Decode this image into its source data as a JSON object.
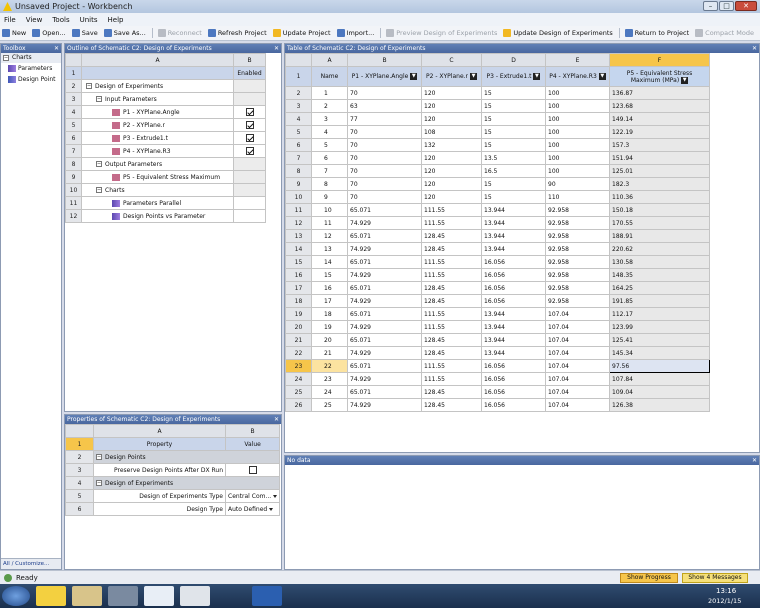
{
  "window": {
    "title": "Unsaved Project - Workbench"
  },
  "menu": [
    "File",
    "View",
    "Tools",
    "Units",
    "Help"
  ],
  "toolbar": [
    {
      "label": "New",
      "icon": "new-icon",
      "enabled": true
    },
    {
      "label": "Open...",
      "icon": "open-icon",
      "enabled": true
    },
    {
      "label": "Save",
      "icon": "save-icon",
      "enabled": true
    },
    {
      "label": "Save As...",
      "icon": "save-as-icon",
      "enabled": true
    },
    {
      "label": "Reconnect",
      "icon": "reconnect-icon",
      "enabled": false
    },
    {
      "label": "Refresh Project",
      "icon": "refresh-icon",
      "enabled": true
    },
    {
      "label": "Update Project",
      "icon": "lightning-icon",
      "enabled": true
    },
    {
      "label": "Import...",
      "icon": "import-icon",
      "enabled": true
    },
    {
      "label": "Preview Design of Experiments",
      "icon": "preview-icon",
      "enabled": false
    },
    {
      "label": "Update Design of Experiments",
      "icon": "lightning-icon",
      "enabled": true
    },
    {
      "label": "Return to Project",
      "icon": "return-icon",
      "enabled": true
    },
    {
      "label": "Compact Mode",
      "icon": "compact-icon",
      "enabled": false
    }
  ],
  "toolbox": {
    "title": "Toolbox",
    "group": "Charts",
    "items": [
      "Parameters",
      "Design Point"
    ],
    "footer": "All / Customize..."
  },
  "outline": {
    "title": "Outline of Schematic C2: Design of Experiments",
    "col_a": "A",
    "col_b": "B",
    "enabled_header": "Enabled",
    "rows": [
      {
        "n": "2",
        "text": "Design of Experiments",
        "level": 0,
        "toggle": "−"
      },
      {
        "n": "3",
        "text": "Input Parameters",
        "level": 1,
        "toggle": "−"
      },
      {
        "n": "4",
        "text": "P1 - XYPlane.Angle",
        "level": 2,
        "checked": true
      },
      {
        "n": "5",
        "text": "P2 - XYPlane.r",
        "level": 2,
        "checked": true
      },
      {
        "n": "6",
        "text": "P3 - Extrude1.t",
        "level": 2,
        "checked": true
      },
      {
        "n": "7",
        "text": "P4 - XYPlane.R3",
        "level": 2,
        "checked": true
      },
      {
        "n": "8",
        "text": "Output Parameters",
        "level": 1,
        "toggle": "−"
      },
      {
        "n": "9",
        "text": "P5 - Equivalent Stress Maximum",
        "level": 2
      },
      {
        "n": "10",
        "text": "Charts",
        "level": 1,
        "toggle": "−"
      },
      {
        "n": "11",
        "text": "Parameters Parallel",
        "level": 2
      },
      {
        "n": "12",
        "text": "Design Points vs Parameter",
        "level": 2
      }
    ]
  },
  "properties": {
    "title": "Properties of Schematic C2: Design of Experiments",
    "col_a": "A",
    "col_b": "B",
    "property_header": "Property",
    "value_header": "Value",
    "rows": [
      {
        "n": "2",
        "section": "Design Points"
      },
      {
        "n": "3",
        "label": "Preserve Design Points After DX Run",
        "type": "checkbox"
      },
      {
        "n": "4",
        "section": "Design of Experiments"
      },
      {
        "n": "5",
        "label": "Design of Experiments Type",
        "value": "Central Com..."
      },
      {
        "n": "6",
        "label": "Design Type",
        "value": "Auto Defined"
      }
    ]
  },
  "doe_table": {
    "title": "Table of Schematic C2: Design of Experiments",
    "cols": [
      "A",
      "B",
      "C",
      "D",
      "E",
      "F"
    ],
    "headers": [
      "Name",
      "P1 - XYPlane.Angle",
      "P2 - XYPlane.r",
      "P3 - Extrude1.t",
      "P4 - XYPlane.R3",
      "P5 - Equivalent Stress Maximum (MPa)"
    ],
    "selected_row": "23",
    "rows": [
      [
        "1",
        "70",
        "120",
        "15",
        "100",
        "136.87"
      ],
      [
        "2",
        "63",
        "120",
        "15",
        "100",
        "123.68"
      ],
      [
        "3",
        "77",
        "120",
        "15",
        "100",
        "149.14"
      ],
      [
        "4",
        "70",
        "108",
        "15",
        "100",
        "122.19"
      ],
      [
        "5",
        "70",
        "132",
        "15",
        "100",
        "157.3"
      ],
      [
        "6",
        "70",
        "120",
        "13.5",
        "100",
        "151.94"
      ],
      [
        "7",
        "70",
        "120",
        "16.5",
        "100",
        "125.01"
      ],
      [
        "8",
        "70",
        "120",
        "15",
        "90",
        "182.3"
      ],
      [
        "9",
        "70",
        "120",
        "15",
        "110",
        "110.36"
      ],
      [
        "10",
        "65.071",
        "111.55",
        "13.944",
        "92.958",
        "150.18"
      ],
      [
        "11",
        "74.929",
        "111.55",
        "13.944",
        "92.958",
        "170.55"
      ],
      [
        "12",
        "65.071",
        "128.45",
        "13.944",
        "92.958",
        "188.91"
      ],
      [
        "13",
        "74.929",
        "128.45",
        "13.944",
        "92.958",
        "220.62"
      ],
      [
        "14",
        "65.071",
        "111.55",
        "16.056",
        "92.958",
        "130.58"
      ],
      [
        "15",
        "74.929",
        "111.55",
        "16.056",
        "92.958",
        "148.35"
      ],
      [
        "16",
        "65.071",
        "128.45",
        "16.056",
        "92.958",
        "164.25"
      ],
      [
        "17",
        "74.929",
        "128.45",
        "16.056",
        "92.958",
        "191.85"
      ],
      [
        "18",
        "65.071",
        "111.55",
        "13.944",
        "107.04",
        "112.17"
      ],
      [
        "19",
        "74.929",
        "111.55",
        "13.944",
        "107.04",
        "123.99"
      ],
      [
        "20",
        "65.071",
        "128.45",
        "13.944",
        "107.04",
        "125.41"
      ],
      [
        "21",
        "74.929",
        "128.45",
        "13.944",
        "107.04",
        "145.34"
      ],
      [
        "22",
        "65.071",
        "111.55",
        "16.056",
        "107.04",
        "97.56"
      ],
      [
        "23",
        "74.929",
        "111.55",
        "16.056",
        "107.04",
        "107.84"
      ],
      [
        "24",
        "65.071",
        "128.45",
        "16.056",
        "107.04",
        "109.04"
      ],
      [
        "25",
        "74.929",
        "128.45",
        "16.056",
        "107.04",
        "126.38"
      ]
    ]
  },
  "chart_panel": {
    "title": "No data"
  },
  "status": {
    "text": "Ready",
    "show_progress": "Show Progress",
    "show_messages": "Show 4 Messages"
  },
  "taskbar": {
    "time": "13:16",
    "date": "2012/1/15"
  }
}
